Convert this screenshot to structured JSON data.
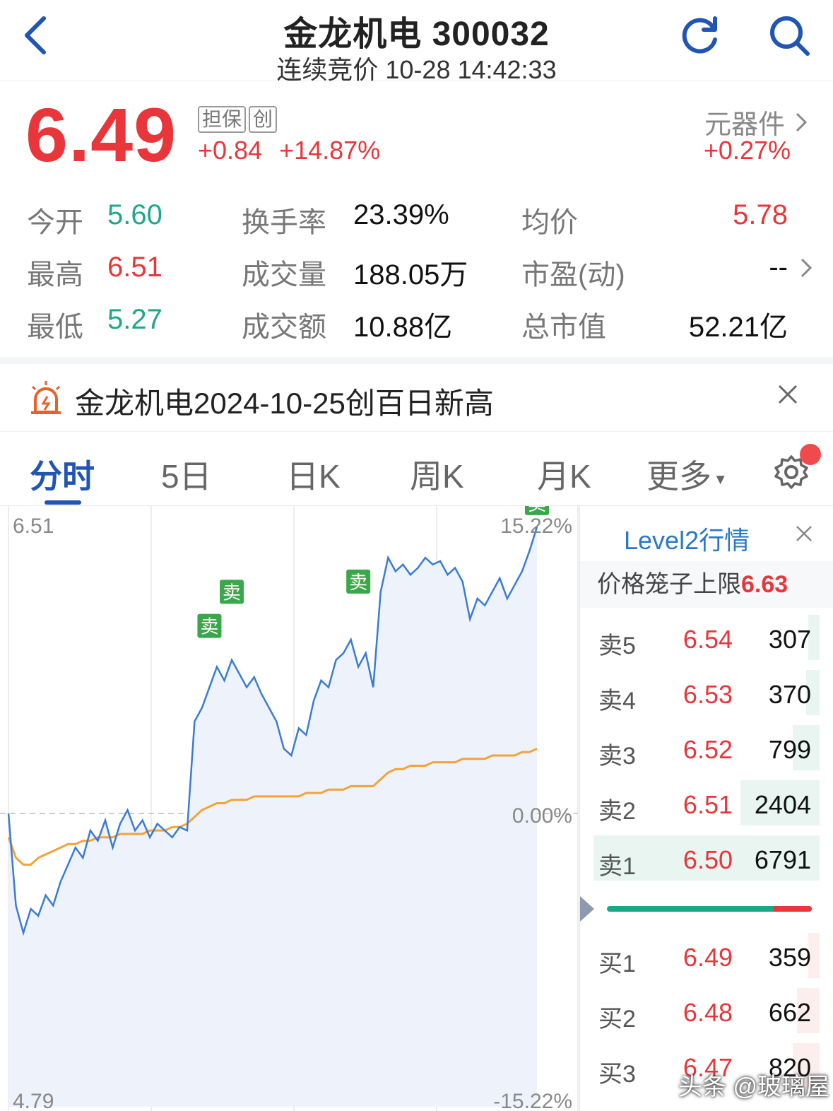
{
  "header": {
    "title": "金龙机电 300032",
    "subtitle": "连续竞价 10-28 14:42:33"
  },
  "quote": {
    "price": "6.49",
    "tags": [
      "担保",
      "创"
    ],
    "change": "+0.84",
    "change_pct": "+14.87%",
    "sector": "元器件",
    "sector_change": "+0.27%"
  },
  "stats": {
    "open_label": "今开",
    "open": "5.60",
    "high_label": "最高",
    "high": "6.51",
    "low_label": "最低",
    "low": "5.27",
    "turnover_label": "换手率",
    "turnover": "23.39%",
    "volume_label": "成交量",
    "volume": "188.05万",
    "amount_label": "成交额",
    "amount": "10.88亿",
    "avg_label": "均价",
    "avg": "5.78",
    "pe_label": "市盈(动)",
    "pe": "--",
    "mcap_label": "总市值",
    "mcap": "52.21亿"
  },
  "notice": {
    "text": "金龙机电2024-10-25创百日新高"
  },
  "tabs": [
    "分时",
    "5日",
    "日K",
    "周K",
    "月K",
    "更多"
  ],
  "chart_data": {
    "type": "line",
    "y_left_ticks": [
      "6.51",
      "4.79"
    ],
    "y_right_ticks": [
      "15.22%",
      "0.00%",
      "-15.22%"
    ],
    "ylim": [
      4.79,
      6.51
    ],
    "baseline": 5.65,
    "marker_label": "卖",
    "series": [
      {
        "values": [
          5.65,
          5.38,
          5.3,
          5.37,
          5.35,
          5.41,
          5.38,
          5.45,
          5.5,
          5.55,
          5.52,
          5.6,
          5.57,
          5.63,
          5.55,
          5.62,
          5.66,
          5.6,
          5.63,
          5.58,
          5.62,
          5.6,
          5.58,
          5.61,
          5.6,
          5.92,
          5.96,
          6.02,
          6.08,
          6.04,
          6.1,
          6.06,
          6.02,
          6.05,
          6.0,
          5.96,
          5.92,
          5.84,
          5.82,
          5.9,
          5.88,
          5.98,
          6.04,
          6.02,
          6.1,
          6.12,
          6.16,
          6.08,
          6.12,
          6.02,
          6.3,
          6.4,
          6.36,
          6.38,
          6.35,
          6.37,
          6.4,
          6.38,
          6.39,
          6.35,
          6.37,
          6.33,
          6.22,
          6.28,
          6.26,
          6.3,
          6.34,
          6.28,
          6.32,
          6.36,
          6.42,
          6.49
        ]
      },
      {
        "values": [
          5.58,
          5.52,
          5.5,
          5.5,
          5.52,
          5.53,
          5.54,
          5.55,
          5.56,
          5.56,
          5.57,
          5.57,
          5.58,
          5.58,
          5.58,
          5.59,
          5.59,
          5.59,
          5.59,
          5.6,
          5.6,
          5.6,
          5.61,
          5.61,
          5.62,
          5.64,
          5.66,
          5.67,
          5.68,
          5.68,
          5.69,
          5.69,
          5.69,
          5.7,
          5.7,
          5.7,
          5.7,
          5.7,
          5.7,
          5.7,
          5.71,
          5.71,
          5.71,
          5.72,
          5.72,
          5.72,
          5.73,
          5.73,
          5.73,
          5.73,
          5.75,
          5.77,
          5.78,
          5.78,
          5.79,
          5.79,
          5.79,
          5.8,
          5.8,
          5.8,
          5.8,
          5.81,
          5.81,
          5.81,
          5.81,
          5.82,
          5.82,
          5.82,
          5.82,
          5.83,
          5.83,
          5.84
        ]
      }
    ]
  },
  "level2": {
    "title": "Level2行情",
    "limit_label": "价格笼子上限",
    "limit_value": "6.63",
    "asks": [
      {
        "label": "卖5",
        "price": "6.54",
        "volume": "307",
        "depth": 0.05
      },
      {
        "label": "卖4",
        "price": "6.53",
        "volume": "370",
        "depth": 0.06
      },
      {
        "label": "卖3",
        "price": "6.52",
        "volume": "799",
        "depth": 0.12
      },
      {
        "label": "卖2",
        "price": "6.51",
        "volume": "2404",
        "depth": 0.35
      },
      {
        "label": "卖1",
        "price": "6.50",
        "volume": "6791",
        "depth": 1.0
      }
    ],
    "bids": [
      {
        "label": "买1",
        "price": "6.49",
        "volume": "359",
        "depth": 0.05
      },
      {
        "label": "买2",
        "price": "6.48",
        "volume": "662",
        "depth": 0.1
      },
      {
        "label": "买3",
        "price": "6.47",
        "volume": "820",
        "depth": 0.12
      }
    ]
  },
  "watermark": "头条 @玻璃屋"
}
